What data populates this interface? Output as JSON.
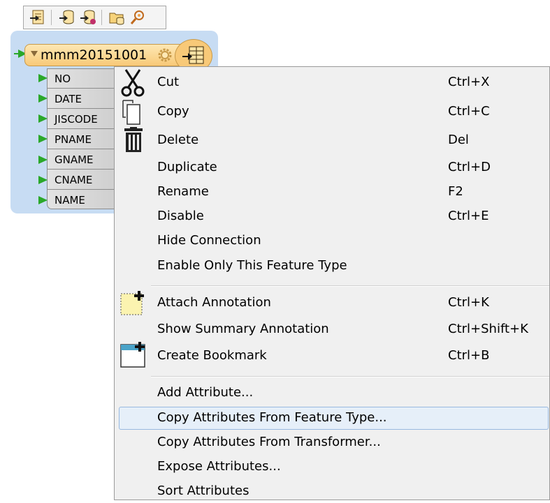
{
  "toolbar": {
    "buttons": [
      {
        "name": "insert-reader-icon"
      },
      {
        "name": "add-source-icon"
      },
      {
        "name": "remove-source-icon"
      },
      {
        "name": "open-folder-icon"
      },
      {
        "name": "inspect-icon"
      }
    ]
  },
  "node": {
    "title": "mmm20151001",
    "attributes": [
      "NO",
      "DATE",
      "JISCODE",
      "PNAME",
      "GNAME",
      "CNAME",
      "NAME"
    ]
  },
  "menu": {
    "items": [
      {
        "label": "Cut",
        "shortcut": "Ctrl+X",
        "icon": "scissors-icon"
      },
      {
        "label": "Copy",
        "shortcut": "Ctrl+C",
        "icon": "copy-icon"
      },
      {
        "label": "Delete",
        "shortcut": "Del",
        "icon": "trash-icon"
      },
      {
        "label": "Duplicate",
        "shortcut": "Ctrl+D"
      },
      {
        "label": "Rename",
        "shortcut": "F2"
      },
      {
        "label": "Disable",
        "shortcut": "Ctrl+E"
      },
      {
        "label": "Hide Connection",
        "shortcut": ""
      },
      {
        "label": "Enable Only This Feature Type",
        "shortcut": ""
      },
      {
        "label": "Attach Annotation",
        "shortcut": "Ctrl+K",
        "icon": "annotation-icon"
      },
      {
        "label": "Show Summary Annotation",
        "shortcut": "Ctrl+Shift+K"
      },
      {
        "label": "Create Bookmark",
        "shortcut": "Ctrl+B",
        "icon": "bookmark-icon"
      },
      {
        "label": "Add Attribute...",
        "shortcut": ""
      },
      {
        "label": "Copy Attributes From Feature Type...",
        "shortcut": "",
        "highlighted": true
      },
      {
        "label": "Copy Attributes From Transformer...",
        "shortcut": ""
      },
      {
        "label": "Expose Attributes...",
        "shortcut": ""
      },
      {
        "label": "Sort Attributes",
        "shortcut": ""
      }
    ]
  },
  "colors": {
    "node_header": "#f8c978",
    "node_background": "#c7dcf3",
    "port_green": "#2aa82a",
    "menu_background": "#f0f0f0",
    "menu_highlight": "#e6eff9"
  }
}
